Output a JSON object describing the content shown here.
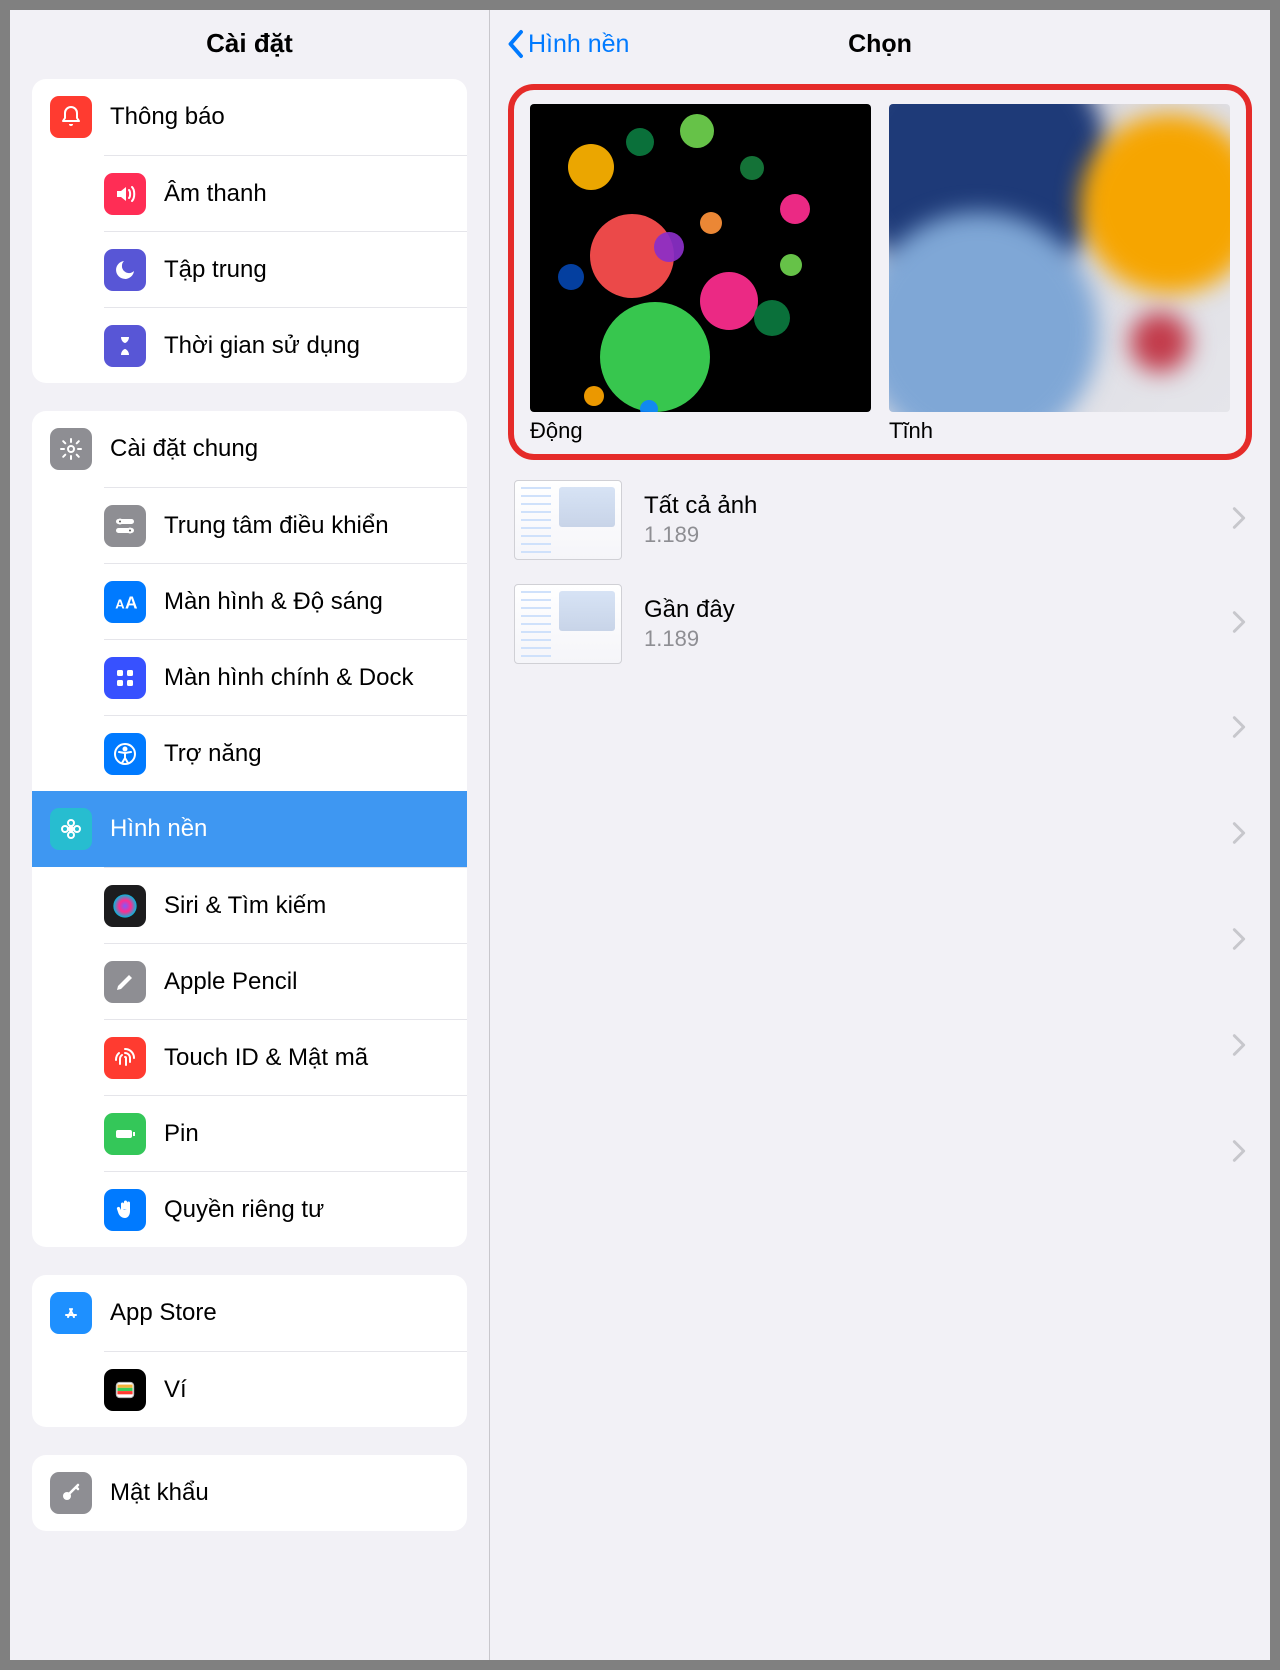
{
  "sidebar": {
    "title": "Cài đặt",
    "groups": [
      {
        "items": [
          {
            "id": "notifications",
            "label": "Thông báo",
            "iconColor": "#ff3b30",
            "glyph": "bell"
          },
          {
            "id": "sound",
            "label": "Âm thanh",
            "iconColor": "#ff2d55",
            "glyph": "speaker"
          },
          {
            "id": "focus",
            "label": "Tập trung",
            "iconColor": "#5856d6",
            "glyph": "moon"
          },
          {
            "id": "screentime",
            "label": "Thời gian sử dụng",
            "iconColor": "#5856d6",
            "glyph": "hourglass"
          }
        ]
      },
      {
        "items": [
          {
            "id": "general",
            "label": "Cài đặt chung",
            "iconColor": "#8e8e93",
            "glyph": "gear"
          },
          {
            "id": "controlcenter",
            "label": "Trung tâm điều khiển",
            "iconColor": "#8e8e93",
            "glyph": "switches"
          },
          {
            "id": "display",
            "label": "Màn hình & Độ sáng",
            "iconColor": "#007aff",
            "glyph": "aa"
          },
          {
            "id": "homescreen",
            "label": "Màn hình chính & Dock",
            "iconColor": "#3751ff",
            "glyph": "grid"
          },
          {
            "id": "accessibility",
            "label": "Trợ năng",
            "iconColor": "#007aff",
            "glyph": "accessibility"
          },
          {
            "id": "wallpaper",
            "label": "Hình nền",
            "iconColor": "#27bdd0",
            "glyph": "flower",
            "selected": true
          },
          {
            "id": "siri",
            "label": "Siri & Tìm kiếm",
            "iconColor": "#1c1c1e",
            "glyph": "siri"
          },
          {
            "id": "pencil",
            "label": "Apple Pencil",
            "iconColor": "#8e8e93",
            "glyph": "pencil"
          },
          {
            "id": "touchid",
            "label": "Touch ID & Mật mã",
            "iconColor": "#ff3b30",
            "glyph": "fingerprint"
          },
          {
            "id": "battery",
            "label": "Pin",
            "iconColor": "#34c759",
            "glyph": "battery"
          },
          {
            "id": "privacy",
            "label": "Quyền riêng tư",
            "iconColor": "#007aff",
            "glyph": "hand"
          }
        ]
      },
      {
        "items": [
          {
            "id": "appstore",
            "label": "App Store",
            "iconColor": "#1e90ff",
            "glyph": "appstore"
          },
          {
            "id": "wallet",
            "label": "Ví",
            "iconColor": "#000",
            "glyph": "wallet"
          }
        ]
      },
      {
        "items": [
          {
            "id": "passwords",
            "label": "Mật khẩu",
            "iconColor": "#8e8e93",
            "glyph": "key"
          }
        ]
      }
    ]
  },
  "detail": {
    "backLabel": "Hình nền",
    "title": "Chọn",
    "previews": [
      {
        "id": "dynamic",
        "label": "Động"
      },
      {
        "id": "static",
        "label": "Tĩnh"
      }
    ],
    "albums": [
      {
        "id": "all",
        "title": "Tất cả ảnh",
        "count": "1.189"
      },
      {
        "id": "recent",
        "title": "Gần đây",
        "count": "1.189"
      }
    ],
    "extraRows": 5
  },
  "colors": {
    "highlight": "#e52b29",
    "selection": "#3e97f2",
    "link": "#007aff"
  }
}
